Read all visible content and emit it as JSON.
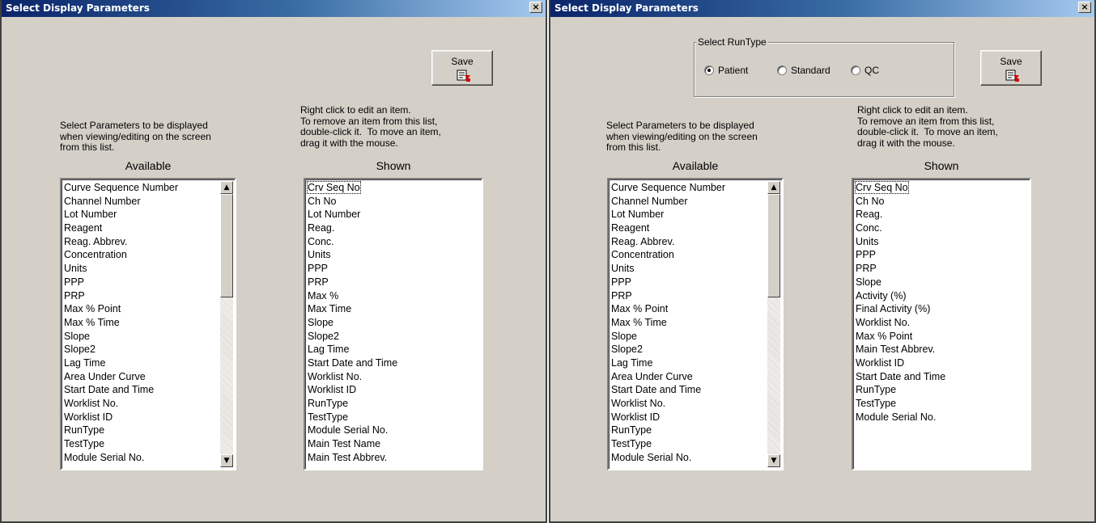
{
  "windows": [
    {
      "title": "Select Display Parameters",
      "close": "×",
      "save_label": "Save",
      "left_hint": "Select Parameters to be displayed\nwhen viewing/editing on the screen\nfrom this list.",
      "right_hint": "Right click to edit an item.\nTo remove an item from this list,\ndouble-click it.  To move an item,\ndrag it with the mouse.",
      "available_heading": "Available",
      "shown_heading": "Shown",
      "available_items": [
        "Curve Sequence Number",
        "Channel Number",
        "Lot Number",
        "Reagent",
        "Reag. Abbrev.",
        "Concentration",
        "Units",
        "PPP",
        "PRP",
        "Max % Point",
        "Max % Time",
        "Slope",
        "Slope2",
        "Lag Time",
        "Area Under Curve",
        "Start Date and Time",
        "Worklist No.",
        "Worklist ID",
        "RunType",
        "TestType",
        "Module Serial  No."
      ],
      "shown_items": [
        "Crv Seq No",
        "Ch No",
        "Lot Number",
        " Reag.",
        "Conc.",
        "Units",
        "PPP",
        "PRP",
        "Max %",
        "Max Time",
        "Slope",
        "Slope2",
        "Lag Time",
        "Start Date and Time",
        "Worklist No.",
        "Worklist ID",
        "RunType",
        "TestType",
        "Module Serial No.",
        "Main Test Name",
        "Main Test Abbrev."
      ]
    },
    {
      "title": "Select Display Parameters",
      "close": "×",
      "save_label": "Save",
      "runtype_group_label": "Select RunType",
      "runtype_options": [
        {
          "label": "Patient",
          "selected": true
        },
        {
          "label": "Standard",
          "selected": false
        },
        {
          "label": "QC",
          "selected": false
        }
      ],
      "left_hint": "Select Parameters to be displayed\nwhen viewing/editing on the screen\nfrom this list.",
      "right_hint": "Right click to edit an item.\nTo remove an item from this list,\ndouble-click it.  To move an item,\ndrag it with the mouse.",
      "available_heading": "Available",
      "shown_heading": "Shown",
      "available_items": [
        "Curve Sequence Number",
        "Channel Number",
        "Lot Number",
        "Reagent",
        "Reag. Abbrev.",
        "Concentration",
        "Units",
        "PPP",
        "PRP",
        "Max % Point",
        "Max % Time",
        "Slope",
        "Slope2",
        "Lag Time",
        "Area Under Curve",
        "Start Date and Time",
        "Worklist No.",
        "Worklist ID",
        "RunType",
        "TestType",
        "Module Serial  No."
      ],
      "shown_items": [
        "Crv Seq No",
        "Ch No",
        "Reag.",
        "Conc.",
        "Units",
        "PPP",
        "PRP",
        "Slope",
        "Activity (%)",
        "Final Activity (%)",
        "Worklist No.",
        "Max % Point",
        "Main Test Abbrev.",
        "Worklist ID",
        "Start Date and Time",
        "RunType",
        "TestType",
        "Module Serial No."
      ]
    }
  ]
}
